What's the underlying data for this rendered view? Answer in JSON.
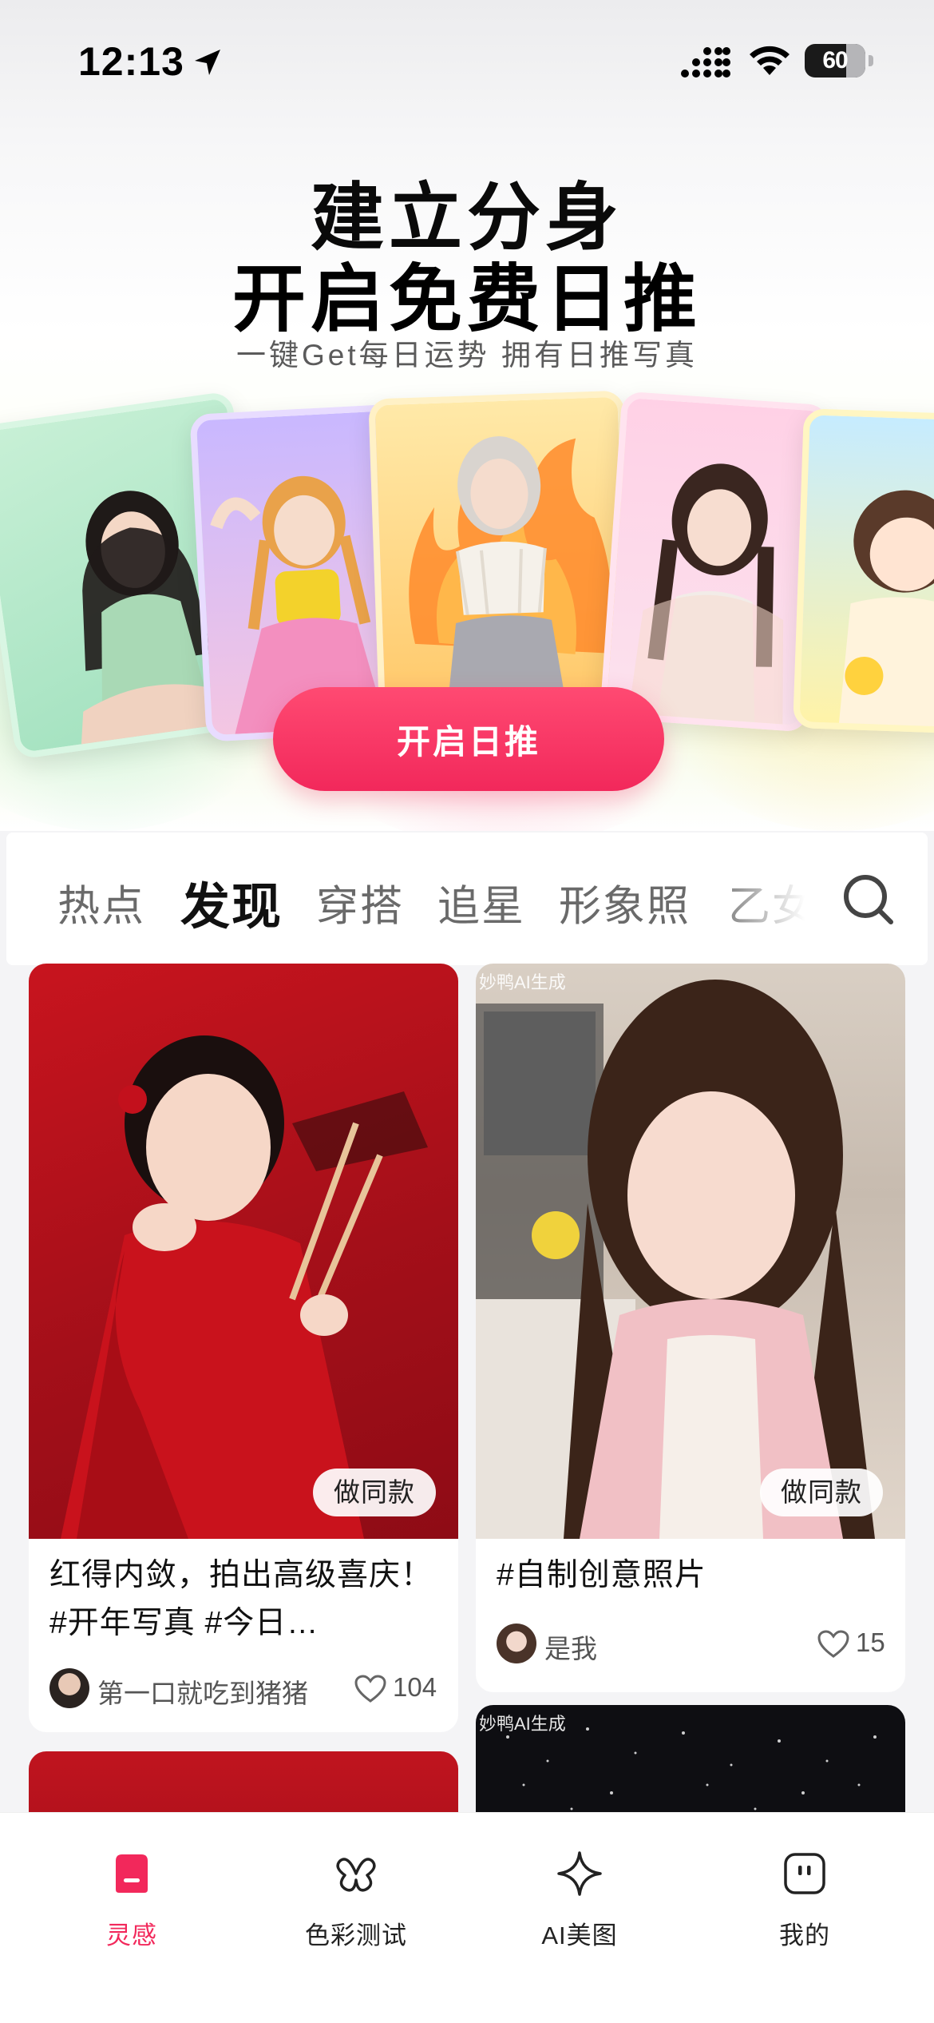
{
  "status_bar": {
    "time": "12:13",
    "battery": "60",
    "battery_level": 0.6
  },
  "hero": {
    "title_line1": "建立分身",
    "title_line2": "开启免费日推",
    "subtitle": "一键Get每日运势 拥有日推写真",
    "cta_label": "开启日推"
  },
  "tabs": {
    "items": [
      "热点",
      "发现",
      "穿搭",
      "追星",
      "形象照",
      "乙女"
    ],
    "active": "发现"
  },
  "feed": {
    "make_same_label": "做同款",
    "cards": [
      {
        "title": "红得内敛，拍出高级喜庆！ #开年写真 #今日…",
        "author": "第一口就吃到猪猪",
        "likes": "104"
      },
      {
        "title": "#自制创意照片",
        "author": "是我",
        "likes": "15"
      }
    ],
    "ai_tag": "妙鸭AI生成"
  },
  "bottom_nav": {
    "items": [
      {
        "label": "灵感",
        "icon": "inspiration-icon",
        "active": true
      },
      {
        "label": "色彩测试",
        "icon": "butterfly-icon",
        "active": false
      },
      {
        "label": "AI美图",
        "icon": "sparkle-icon",
        "active": false
      },
      {
        "label": "我的",
        "icon": "profile-face-icon",
        "active": false
      }
    ]
  },
  "colors": {
    "accent": "#f2285b",
    "text": "#111111",
    "muted": "#555555"
  }
}
